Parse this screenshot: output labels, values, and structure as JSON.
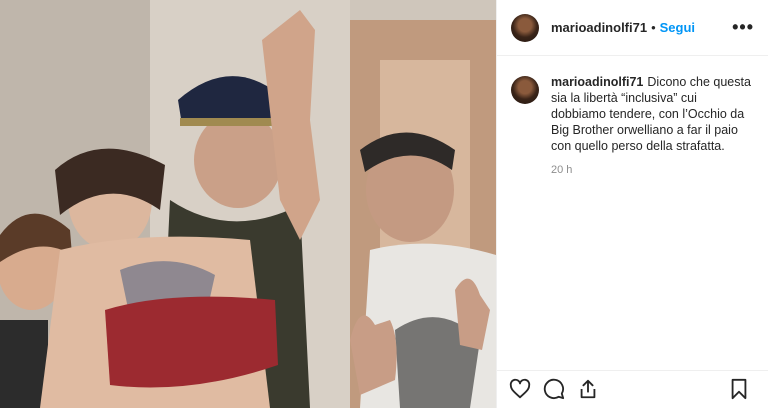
{
  "post": {
    "author": "marioadinolfi71",
    "separator": "•",
    "follow_label": "Segui",
    "more_label": "•••"
  },
  "caption": {
    "author": "marioadinolfi71",
    "text": "Dicono che questa sia la libertà “inclusiva” cui dobbiamo tendere, con l’Occhio da Big Brother orwelliano a far il paio con quello perso della strafatta.",
    "time": "20 h"
  },
  "icons": {
    "like": "heart-icon",
    "comment": "comment-icon",
    "share": "share-icon",
    "save": "bookmark-icon",
    "more": "more-options-icon"
  },
  "colors": {
    "link": "#0095f6",
    "text": "#262626",
    "muted": "#8e8e8e",
    "border": "#efefef"
  }
}
